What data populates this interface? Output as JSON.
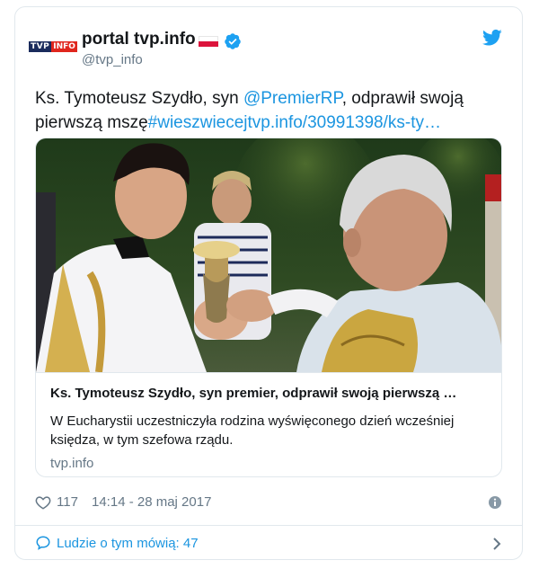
{
  "account": {
    "display_name": "portal tvp.info",
    "handle": "@tvp_info",
    "logo_text_tvp": "TVP",
    "logo_text_info": "INFO",
    "verified": true,
    "flag": "Poland"
  },
  "tweet": {
    "text_plain_1": "Ks. Tymoteusz Szydło, syn ",
    "mention": "@PremierRP",
    "text_plain_2": ", odprawił swoją pierwszą mszę",
    "link": "#wieszwiecejtvp.info/30991398/ks-ty…"
  },
  "card": {
    "title": "Ks. Tymoteusz Szydło, syn premier, odprawił swoją pierwszą …",
    "description": "W Eucharystii uczestniczyła rodzina wyświęconego dzień wcześniej księdza, w tym szefowa rządu.",
    "domain": "tvp.info"
  },
  "meta": {
    "likes": "117",
    "timestamp": "14:14 - 28 maj 2017"
  },
  "footer": {
    "label": "Ludzie o tym mówią: 47"
  },
  "colors": {
    "link": "#1b95e0",
    "muted": "#657786",
    "border": "#e1e8ed"
  },
  "icons": [
    "verified-icon",
    "twitter-bird-icon",
    "heart-icon",
    "info-icon",
    "speech-bubble-icon",
    "chevron-right-icon"
  ]
}
